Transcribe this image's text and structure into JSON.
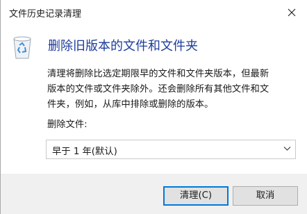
{
  "window": {
    "title": "文件历史记录清理"
  },
  "main": {
    "icon": "recycle-bin-icon",
    "heading": "删除旧版本的文件和文件夹",
    "description_lines": [
      "清理将删除比选定期限早的文件和文件夹版本，但最新",
      "版本的文件或文件夹除外。还会删除所有其他文件和文",
      "件夹，例如，从库中排除或删除的版本。"
    ],
    "field_label": "删除文件:",
    "select": {
      "value": "早于 1 年(默认)"
    }
  },
  "buttons": {
    "ok": "清理(C)",
    "cancel": "取消"
  },
  "colors": {
    "heading": "#1d3c9c",
    "accent": "#0078d7",
    "footer": "#f0f0f0"
  }
}
